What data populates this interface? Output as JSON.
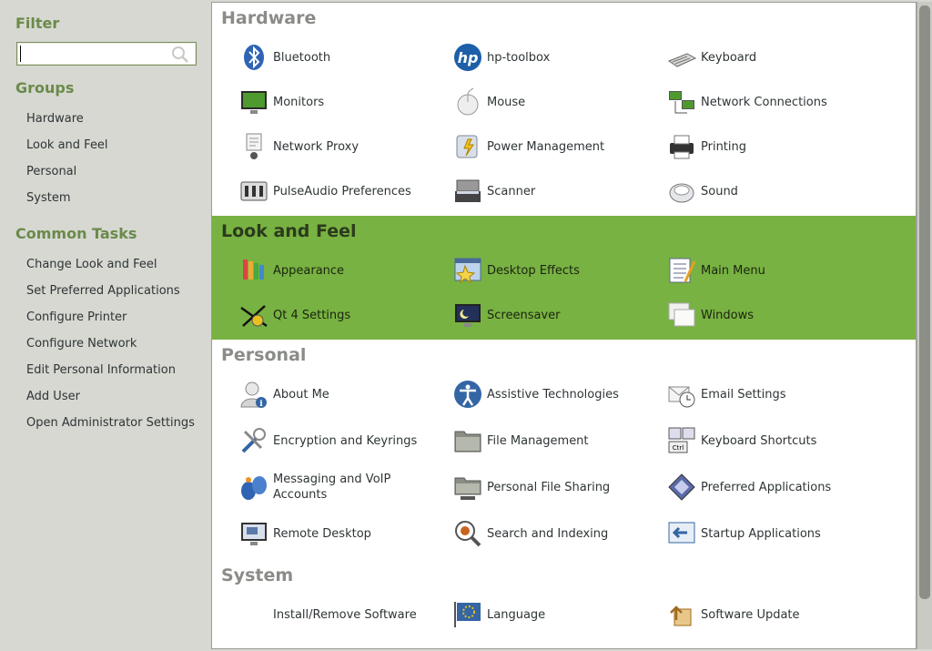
{
  "sidebar": {
    "filter_heading": "Filter",
    "search_value": "",
    "groups_heading": "Groups",
    "groups": [
      "Hardware",
      "Look and Feel",
      "Personal",
      "System"
    ],
    "tasks_heading": "Common Tasks",
    "tasks": [
      "Change Look and Feel",
      "Set Preferred Applications",
      "Configure Printer",
      "Configure Network",
      "Edit Personal Information",
      "Add User",
      "Open Administrator Settings"
    ]
  },
  "sections": {
    "hardware": {
      "title": "Hardware",
      "items": [
        "Bluetooth",
        "hp-toolbox",
        "Keyboard",
        "Monitors",
        "Mouse",
        "Network Connections",
        "Network Proxy",
        "Power Management",
        "Printing",
        "PulseAudio Preferences",
        "Scanner",
        "Sound"
      ]
    },
    "lookfeel": {
      "title": "Look and Feel",
      "highlight_color": "#78b242",
      "items": [
        "Appearance",
        "Desktop Effects",
        "Main Menu",
        "Qt 4 Settings",
        "Screensaver",
        "Windows"
      ]
    },
    "personal": {
      "title": "Personal",
      "items": [
        "About Me",
        "Assistive Technologies",
        "Email Settings",
        "Encryption and Keyrings",
        "File Management",
        "Keyboard Shortcuts",
        "Messaging and VoIP Accounts",
        "Personal File Sharing",
        "Preferred Applications",
        "Remote Desktop",
        "Search and Indexing",
        "Startup Applications"
      ]
    },
    "system": {
      "title": "System",
      "items": [
        "Install/Remove Software",
        "Language",
        "Software Update"
      ]
    }
  },
  "icons": {
    "hardware": [
      "bluetooth-icon",
      "hp-icon",
      "keyboard-icon",
      "monitor-icon",
      "mouse-icon",
      "network-icon",
      "network-proxy-icon",
      "power-icon",
      "printer-icon",
      "audio-mixer-icon",
      "scanner-icon",
      "sound-icon"
    ],
    "lookfeel": [
      "appearance-icon",
      "desktop-effects-icon",
      "main-menu-icon",
      "qt-settings-icon",
      "screensaver-icon",
      "windows-icon"
    ],
    "personal": [
      "about-me-icon",
      "accessibility-icon",
      "email-icon",
      "keyring-icon",
      "folder-icon",
      "keyboard-shortcuts-icon",
      "messaging-icon",
      "file-sharing-icon",
      "preferred-apps-icon",
      "remote-desktop-icon",
      "search-index-icon",
      "startup-icon"
    ],
    "system": [
      "none",
      "language-flag-icon",
      "software-update-icon"
    ]
  }
}
